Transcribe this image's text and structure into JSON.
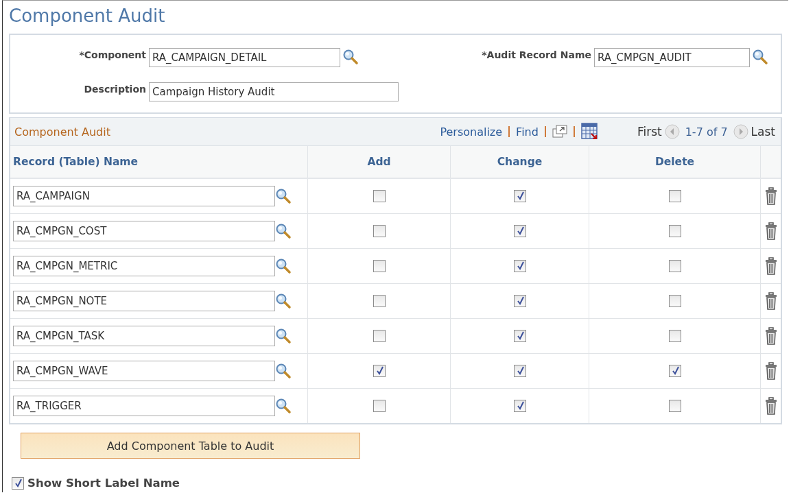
{
  "page_title": "Component Audit",
  "criteria": {
    "component": {
      "label": "*Component",
      "value": "RA_CAMPAIGN_DETAIL"
    },
    "audit_record_name": {
      "label": "*Audit Record Name",
      "value": "RA_CMPGN_AUDIT"
    },
    "description": {
      "label": "Description",
      "value": "Campaign History Audit"
    }
  },
  "grid": {
    "title": "Component Audit",
    "links": [
      "Personalize",
      "Find"
    ],
    "first": "First",
    "range": "1-7 of 7",
    "last": "Last",
    "columns": [
      "Record (Table) Name",
      "Add",
      "Change",
      "Delete"
    ],
    "rows": [
      {
        "record": "RA_CAMPAIGN",
        "add": false,
        "change": true,
        "delete": false
      },
      {
        "record": "RA_CMPGN_COST",
        "add": false,
        "change": true,
        "delete": false
      },
      {
        "record": "RA_CMPGN_METRIC",
        "add": false,
        "change": true,
        "delete": false
      },
      {
        "record": "RA_CMPGN_NOTE",
        "add": false,
        "change": true,
        "delete": false
      },
      {
        "record": "RA_CMPGN_TASK",
        "add": false,
        "change": true,
        "delete": false
      },
      {
        "record": "RA_CMPGN_WAVE",
        "add": true,
        "change": true,
        "delete": true
      },
      {
        "record": "RA_TRIGGER",
        "add": false,
        "change": true,
        "delete": false
      }
    ]
  },
  "add_button": "Add Component Table to Audit",
  "show_short_label": {
    "label": "Show Short Label Name",
    "checked": true
  }
}
